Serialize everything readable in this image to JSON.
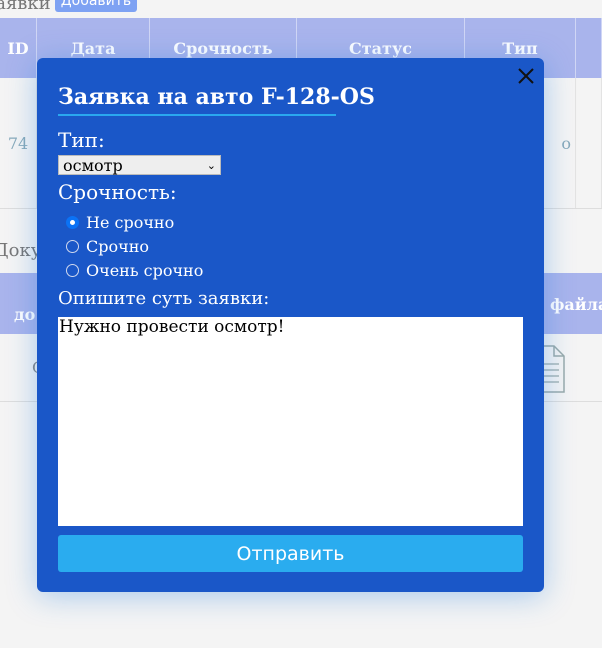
{
  "background": {
    "header_label": "Заявки",
    "add_button": "Добавить",
    "requests_table": {
      "columns": [
        "ID",
        "Дата",
        "Срочность",
        "Статус",
        "Тип",
        ""
      ],
      "rows": [
        {
          "id": "74",
          "type_partial": "о"
        }
      ]
    },
    "documents_label": "Доку",
    "documents_table": {
      "col_first_partial": "до",
      "col_files_partial": "файла",
      "row_first_partial": "С"
    }
  },
  "modal": {
    "title": "Заявка на авто F-128-OS",
    "type_label": "Тип:",
    "type_value": "осмотр",
    "urgency_label": "Срочность:",
    "urgency_options": [
      "Не срочно",
      "Срочно",
      "Очень срочно"
    ],
    "urgency_selected": "Не срочно",
    "description_label": "Опишите суть заявки:",
    "description_value": "Нужно провести осмотр!",
    "submit_label": "Отправить"
  },
  "icons": {
    "close": "close-icon",
    "document": "document-icon",
    "dropdown": "chevron-down-icon"
  },
  "colors": {
    "modal_bg": "#1a57c8",
    "submit_bg": "#2aacef",
    "title_underline": "#2aa8ef",
    "table_header_bg": "#a9b4ec"
  }
}
